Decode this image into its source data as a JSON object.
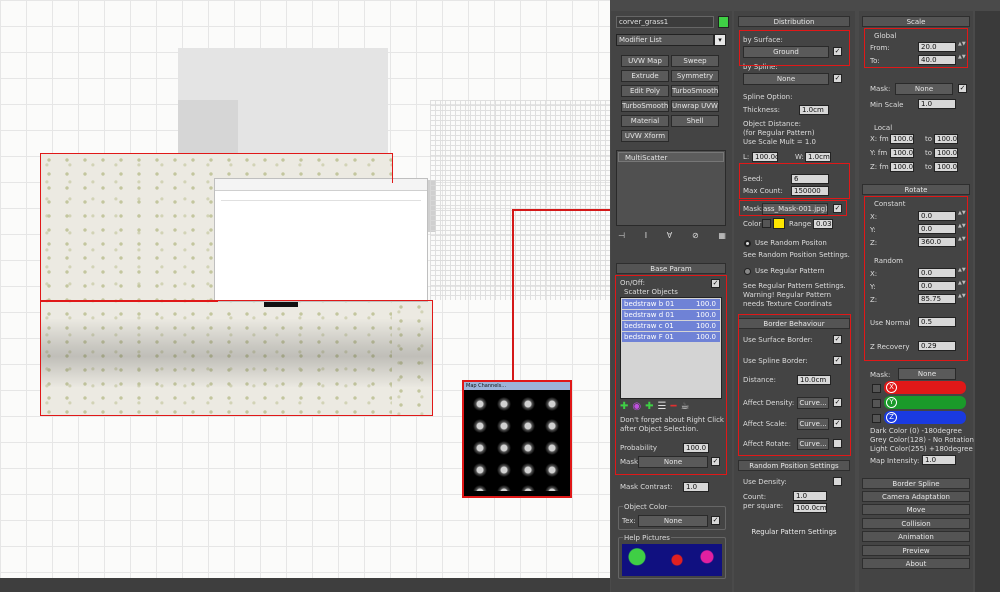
{
  "colors": {
    "accent_red": "#e01818",
    "panel_bg": "#444444",
    "list_highlight": "#6f82d6",
    "swatch_yellow": "#ffe600",
    "swatch_green": "#3fcf45"
  },
  "modifier_panel": {
    "object_name": "corver_grass1",
    "modifier_list": "Modifier List",
    "buttons": [
      "UVW Map",
      "Sweep",
      "Extrude",
      "Symmetry",
      "Edit Poly",
      "TurboSmooth",
      "TurboSmooth",
      "Unwrap UVW",
      "Material",
      "Shell",
      "UVW Xform"
    ],
    "stack_item": "MultiScatter"
  },
  "base_param": {
    "title": "Base Param",
    "on_off": "On/Off:",
    "scatter_objects": "Scatter Objects",
    "items": [
      {
        "name": "bedstraw b 01",
        "value": "100.0"
      },
      {
        "name": "bedstraw d 01",
        "value": "100.0"
      },
      {
        "name": "bedstraw c 01",
        "value": "100.0"
      },
      {
        "name": "bedstraw F 01",
        "value": "100.0"
      }
    ],
    "hint": "Don't forget about Right Click after Object Selection.",
    "probability_label": "Probability",
    "probability_value": "100.0",
    "mask_label": "Mask",
    "mask_value": "None",
    "mask_contrast_label": "Mask Contrast:",
    "mask_contrast_value": "1.0",
    "object_color_title": "Object Color",
    "tex_label": "Tex:",
    "tex_value": "None",
    "help_pictures_title": "Help Pictures"
  },
  "distribution": {
    "title": "Distribution",
    "by_surface_label": "by Surface:",
    "by_surface_value": "Ground",
    "by_spline_label": "by Spline:",
    "by_spline_value": "None",
    "spline_option": "Spline Option:",
    "thickness_label": "Thickness:",
    "thickness_value": "1.0cm",
    "object_distance": "Object Distance:",
    "regular_pattern": "(for Regular Pattern)",
    "use_scale_mult": "Use Scale Mult = 1.0",
    "l_label": "L:",
    "l_value": "100.0cl",
    "w_label": "W:",
    "w_value": "1.0cm",
    "seed_label": "Seed:",
    "seed_value": "6",
    "max_count_label": "Max Count:",
    "max_count_value": "150000",
    "mask_label": "Mask:",
    "mask_value": "ass_Mask-001.jpg)",
    "color_label": "Color",
    "range_label": "Range",
    "range_value": "0.03",
    "use_random_position": "Use Random Positon",
    "see_random": "See Random Position Settings.",
    "use_regular_pattern": "Use Regular Pattern",
    "see_regular": "See Regular Pattern Settings.",
    "warning_1": "Warning! Regular Pattern",
    "warning_2": "needs Texture Coordinats"
  },
  "border_behaviour": {
    "title": "Border Behaviour",
    "use_surface_border": "Use Surface Border:",
    "use_spline_border": "Use Spline Border:",
    "distance_label": "Distance:",
    "distance_value": "10.0cm",
    "affect_density": "Affect Density:",
    "affect_scale": "Affect Scale:",
    "affect_rotate": "Affect Rotate:",
    "curve_btn": "Curve..."
  },
  "random_position": {
    "title": "Random Position Settings",
    "use_density": "Use Density:",
    "count_label": "Count:",
    "per_square": "per square:",
    "count_value": "1.0",
    "per_square_value": "100.0cm"
  },
  "regular_pattern_title": "Regular Pattern Settings",
  "scale": {
    "title": "Scale",
    "global": "Global",
    "from_label": "From:",
    "from_value": "20.0",
    "to_label": "To:",
    "to_value": "40.0",
    "mask_label": "Mask:",
    "mask_value": "None",
    "min_scale_label": "Min Scale",
    "min_scale_value": "1.0",
    "local": "Local",
    "x_label": "X: fm",
    "y_label": "Y: fm",
    "z_label": "Z: fm",
    "to_word": "to",
    "local_values": [
      "100.0",
      "100.0",
      "100.0",
      "100.0",
      "100.0",
      "100.0"
    ]
  },
  "rotate": {
    "title": "Rotate",
    "constant": "Constant",
    "x": "X:",
    "y": "Y:",
    "z": "Z:",
    "const_values": [
      "0.0",
      "0.0",
      "360.0"
    ],
    "random": "Random",
    "random_values": [
      "0.0",
      "0.0",
      "85.75"
    ],
    "use_normal_label": "Use Normal",
    "use_normal_value": "0.5",
    "z_recovery_label": "Z Recovery",
    "z_recovery_value": "0.29",
    "mask_label": "Mask:",
    "mask_value": "None",
    "dark_color": "Dark Color (0)    -180degree",
    "grey_color": "Grey Color(128) - No Rotation",
    "light_color": "Light Color(255)   +180degree",
    "map_intensity_label": "Map Intensity:",
    "map_intensity_value": "1.0",
    "axis_letters": [
      "X",
      "Y",
      "Z"
    ]
  },
  "rollouts": [
    "Border Spline",
    "Camera Adaptation",
    "Move",
    "Collision",
    "Animation",
    "Preview",
    "About"
  ],
  "viewport": {
    "mask_window_title": "Map Channels..."
  }
}
